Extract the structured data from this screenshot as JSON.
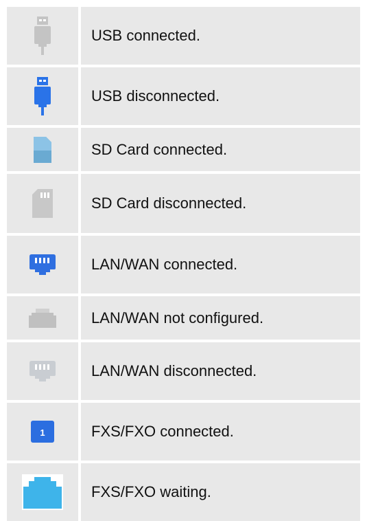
{
  "rows": [
    {
      "icon": "usb-connected-icon",
      "label": "USB connected."
    },
    {
      "icon": "usb-disconnected-icon",
      "label": "USB disconnected."
    },
    {
      "icon": "sd-card-connected-icon",
      "label": "SD Card connected."
    },
    {
      "icon": "sd-card-disconnected-icon",
      "label": "SD Card disconnected."
    },
    {
      "icon": "lan-wan-connected-icon",
      "label": "LAN/WAN connected."
    },
    {
      "icon": "lan-wan-not-configured-icon",
      "label": "LAN/WAN not configured."
    },
    {
      "icon": "lan-wan-disconnected-icon",
      "label": "LAN/WAN disconnected."
    },
    {
      "icon": "fxs-fxo-connected-icon",
      "label": "FXS/FXO connected."
    },
    {
      "icon": "fxs-fxo-waiting-icon",
      "label": "FXS/FXO waiting."
    }
  ],
  "badge_text": "1",
  "colors": {
    "cell_background": "#e8e8e8",
    "usb_gray": "#c4c4c4",
    "usb_blue": "#2a73e8",
    "sd_blue": "#6aaad2",
    "sd_gray": "#c8c8c8",
    "lan_blue": "#2f6fe0",
    "lan_gray": "#c9cdd2",
    "fxs_blue": "#2b6ee0",
    "fxs_light_blue": "#3eb4ea"
  }
}
